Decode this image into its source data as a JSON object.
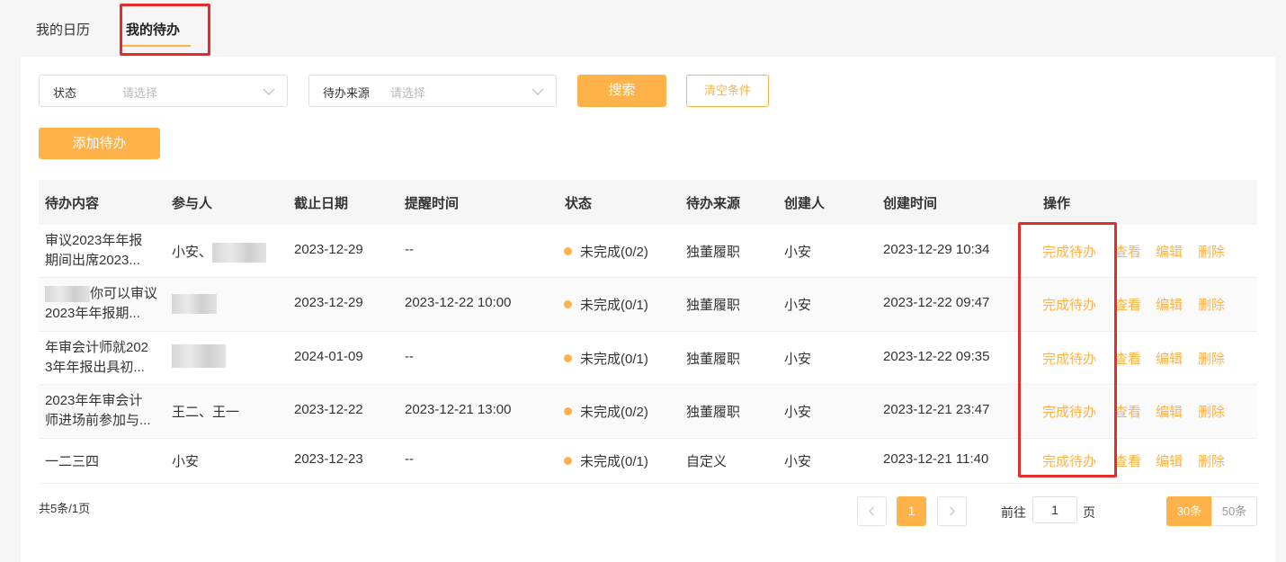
{
  "tabs": {
    "calendar": "我的日历",
    "todo": "我的待办"
  },
  "filters": {
    "status_label": "状态",
    "status_placeholder": "请选择",
    "source_label": "待办来源",
    "source_placeholder": "请选择",
    "search": "搜索",
    "clear": "清空条件"
  },
  "add_button": "添加待办",
  "table": {
    "headers": [
      "待办内容",
      "参与人",
      "截止日期",
      "提醒时间",
      "状态",
      "待办来源",
      "创建人",
      "创建时间",
      "操作"
    ],
    "rows": [
      {
        "content1": "审议2023年年报",
        "content2": "期间出席2023...",
        "participants": "小安、",
        "deadline": "2023-12-29",
        "remind": "--",
        "status": "未完成(0/2)",
        "source": "独董履职",
        "creator": "小安",
        "created": "2023-12-29 10:34"
      },
      {
        "content1": "你可以审议",
        "content2": "2023年年报期...",
        "participants": "",
        "deadline": "2023-12-29",
        "remind": "2023-12-22 10:00",
        "status": "未完成(0/1)",
        "source": "独董履职",
        "creator": "小安",
        "created": "2023-12-22 09:47"
      },
      {
        "content1": "年审会计师就202",
        "content2": "3年年报出具初...",
        "participants": "",
        "deadline": "2024-01-09",
        "remind": "--",
        "status": "未完成(0/1)",
        "source": "独董履职",
        "creator": "小安",
        "created": "2023-12-22 09:35"
      },
      {
        "content1": "2023年年审会计",
        "content2": "师进场前参加与...",
        "participants": "王二、王一",
        "deadline": "2023-12-22",
        "remind": "2023-12-21 13:00",
        "status": "未完成(0/2)",
        "source": "独董履职",
        "creator": "小安",
        "created": "2023-12-21 23:47"
      },
      {
        "content1": "一二三四",
        "content2": "",
        "participants": "小安",
        "deadline": "2023-12-23",
        "remind": "--",
        "status": "未完成(0/1)",
        "source": "自定义",
        "creator": "小安",
        "created": "2023-12-21 11:40"
      }
    ],
    "ops": {
      "complete": "完成待办",
      "view": "查看",
      "edit": "编辑",
      "delete": "删除"
    }
  },
  "pagination": {
    "total_text": "共5条/1页",
    "current_page": "1",
    "goto_prefix": "前往",
    "goto_value": "1",
    "goto_suffix": "页",
    "size_30": "30条",
    "size_50": "50条"
  },
  "colors": {
    "accent": "#ffb24a",
    "highlight": "#e52b2b"
  }
}
